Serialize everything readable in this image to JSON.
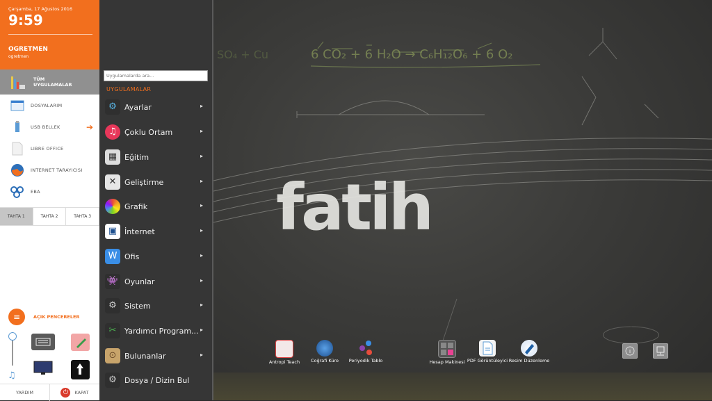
{
  "left_panel": {
    "date": "Çarşamba, 17 Ağustos 2016",
    "time": "9:59",
    "user_name": "OGRETMEN",
    "user_login": "ogretmen",
    "all_apps_line1": "TÜM",
    "all_apps_line2": "UYGULAMALAR",
    "nav": [
      {
        "label": "DOSYALARIM",
        "icon": "folder-icon"
      },
      {
        "label": "USB BELLEK",
        "icon": "usb-icon"
      },
      {
        "label": "LIBRE OFFICE",
        "icon": "document-icon"
      },
      {
        "label": "INTERNET TARAYICISI",
        "icon": "firefox-icon"
      },
      {
        "label": "EBA",
        "icon": "eba-icon"
      }
    ],
    "tabs": [
      "TAHTA 1",
      "TAHTA 2",
      "TAHTA 3"
    ],
    "active_tab": "TAHTA 1",
    "open_windows": "AÇIK PENCERELER",
    "help": "YARDIM",
    "shutdown": "KAPAT"
  },
  "menu": {
    "search_placeholder": "Uygulamalarda ara...",
    "heading": "UYGULAMALAR",
    "items": [
      {
        "label": "Ayarlar",
        "icon": "settings-icon",
        "color": "#2f2f2f"
      },
      {
        "label": "Çoklu Ortam",
        "icon": "music-icon",
        "color": "#e8375a"
      },
      {
        "label": "Eğitim",
        "icon": "calculator-icon",
        "color": "#dddddd"
      },
      {
        "label": "Geliştirme",
        "icon": "tools-icon",
        "color": "#e6e6e6"
      },
      {
        "label": "Grafik",
        "icon": "color-wheel-icon",
        "color": "#f5a623"
      },
      {
        "label": "İnternet",
        "icon": "network-icon",
        "color": "#ffffff"
      },
      {
        "label": "Ofis",
        "icon": "office-icon",
        "color": "#3a8ee6"
      },
      {
        "label": "Oyunlar",
        "icon": "gamepad-icon",
        "color": "#2f2f2f"
      },
      {
        "label": "Sistem",
        "icon": "gear-icon",
        "color": "#2f2f2f"
      },
      {
        "label": "Yardımcı Program...",
        "icon": "accessories-icon",
        "color": "#2f2f2f"
      },
      {
        "label": "Bulunanlar",
        "icon": "box-icon",
        "color": "#c8a46b"
      },
      {
        "label": "Dosya / Dizin Bul",
        "icon": "find-icon",
        "color": "#2f2f2f"
      }
    ]
  },
  "desktop": {
    "logo": "fatih",
    "icons_left": [
      {
        "label": "Antropi Teach",
        "icon": "antropi-icon"
      },
      {
        "label": "Coğrafi Küre",
        "icon": "globe-icon"
      },
      {
        "label": "Periyodik Tablo",
        "icon": "periodic-icon"
      }
    ],
    "icons_right": [
      {
        "label": "Hesap Makinesi",
        "icon": "calculator-icon"
      },
      {
        "label": "PDF Görüntüleyici",
        "icon": "pdf-icon"
      },
      {
        "label": "Resim Düzenleme",
        "icon": "image-edit-icon"
      }
    ]
  }
}
